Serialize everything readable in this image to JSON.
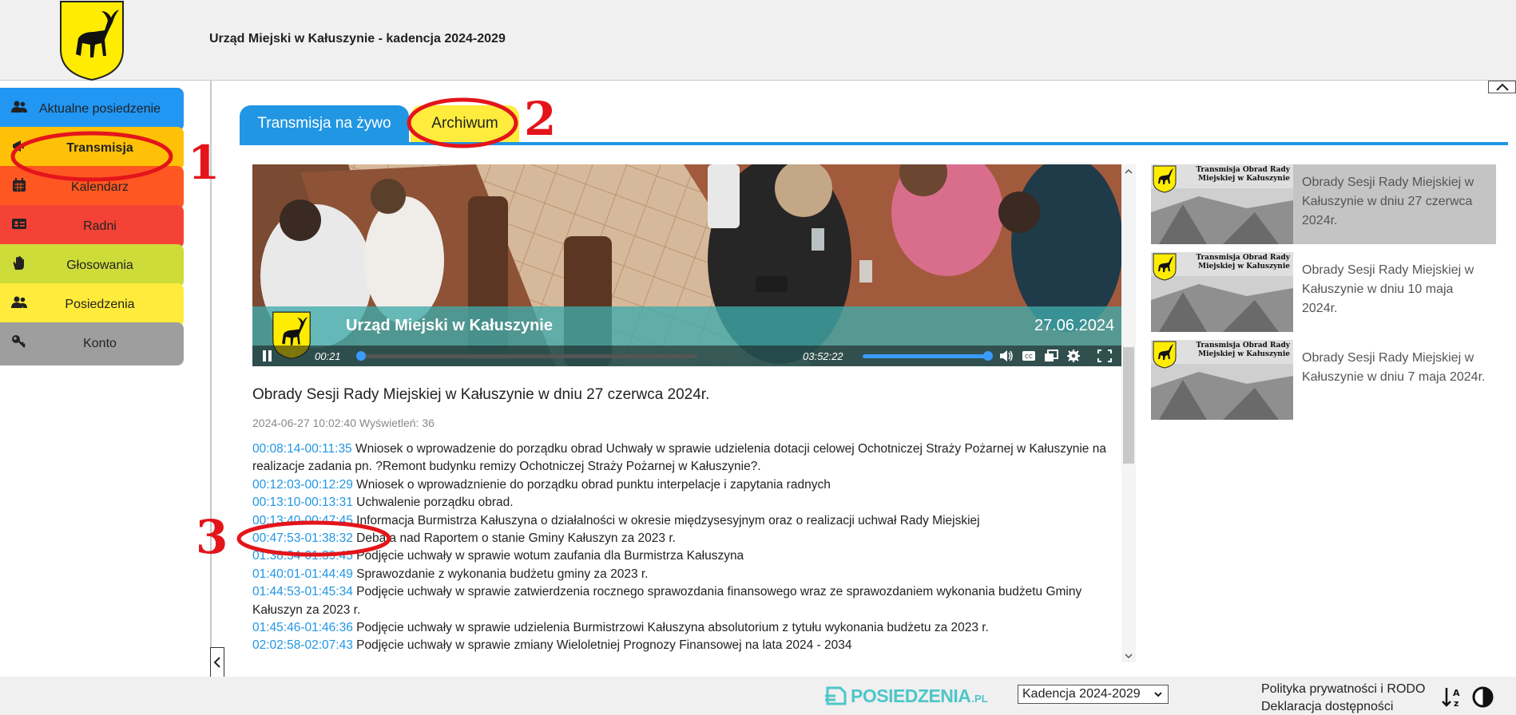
{
  "header": {
    "title": "Urząd Miejski w Kałuszynie - kadencja 2024-2029",
    "logo_icon": "goat-coat-of-arms-icon"
  },
  "sidebar": {
    "items": [
      {
        "label": "Aktualne posiedzenie",
        "icon": "users-icon",
        "color": "#2196f3",
        "text_color": "#222"
      },
      {
        "label": "Transmisja",
        "icon": "broadcast-icon",
        "color": "#ffc107",
        "text_color": "#222",
        "bold": true
      },
      {
        "label": "Kalendarz",
        "icon": "calendar-icon",
        "color": "#ff5722",
        "text_color": "#222"
      },
      {
        "label": "Radni",
        "icon": "id-card-icon",
        "color": "#f44336",
        "text_color": "#222"
      },
      {
        "label": "Głosowania",
        "icon": "hand-icon",
        "color": "#cddc39",
        "text_color": "#222"
      },
      {
        "label": "Posiedzenia",
        "icon": "users-icon",
        "color": "#ffeb3b",
        "text_color": "#222"
      },
      {
        "label": "Konto",
        "icon": "key-icon",
        "color": "#9e9e9e",
        "text_color": "#222"
      }
    ]
  },
  "tabs": {
    "live": "Transmisja na żywo",
    "archive": "Archiwum"
  },
  "player": {
    "overlay_title": "Urząd Miejski w Kałuszynie",
    "overlay_date": "27.06.2024",
    "time_current": "00:21",
    "time_total": "03:52:22",
    "progress_fraction": 0.0015,
    "volume_fraction": 1.0
  },
  "session": {
    "title": "Obrady Sesji Rady Miejskiej w Kałuszynie w dniu 27 czerwca 2024r.",
    "meta": "2024-06-27 10:02:40 Wyświetleń: 36"
  },
  "agenda": [
    {
      "time": "00:08:14-00:11:35",
      "text": "Wniosek o wprowadzenie do porządku obrad Uchwały w sprawie udzielenia dotacji celowej Ochotniczej Straży Pożarnej w Kałuszynie na realizacje zadania pn. ?Remont budynku remizy Ochotniczej Straży Pożarnej w Kałuszynie?."
    },
    {
      "time": "00:12:03-00:12:29",
      "text": "Wniosek o wprowadznienie do porządku obrad punktu interpelacje i zapytania radnych"
    },
    {
      "time": "00:13:10-00:13:31",
      "text": "Uchwalenie porządku obrad."
    },
    {
      "time": "00:13:40-00:47:45",
      "text": "Informacja Burmistrza Kałuszyna o działalności w okresie międzysesyjnym oraz o realizacji uchwał Rady Miejskiej"
    },
    {
      "time": "00:47:53-01:38:32",
      "text": "Debata nad Raportem o stanie Gminy Kałuszyn za 2023 r."
    },
    {
      "time": "01:38:34-01:39:45",
      "text": "Podjęcie uchwały w sprawie wotum zaufania dla Burmistrza Kałuszyna"
    },
    {
      "time": "01:40:01-01:44:49",
      "text": "Sprawozdanie z wykonania budżetu gminy za 2023 r."
    },
    {
      "time": "01:44:53-01:45:34",
      "text": "Podjęcie uchwały w sprawie zatwierdzenia rocznego sprawozdania finansowego wraz ze sprawozdaniem wykonania budżetu Gminy Kałuszyn za 2023 r."
    },
    {
      "time": "01:45:46-01:46:36",
      "text": "Podjęcie uchwały w sprawie udzielenia Burmistrzowi Kałuszyna absolutorium z tytułu wykonania budżetu za 2023 r."
    },
    {
      "time": "02:02:58-02:07:43",
      "text": "Podjęcie uchwały w sprawie zmiany Wieloletniej Prognozy Finansowej na lata 2024 - 2034"
    }
  ],
  "archive": [
    {
      "title": "Obrady Sesji Rady Miejskiej w Kałuszynie w dniu 27 czerwca 2024r.",
      "thumb_title": "Transmisja Obrad Rady Miejskiej w Kałuszynie",
      "active": true
    },
    {
      "title": "Obrady Sesji Rady Miejskiej w Kałuszynie w dniu 10 maja 2024r.",
      "thumb_title": "Transmisja Obrad Rady Miejskiej w Kałuszynie",
      "active": false
    },
    {
      "title": "Obrady Sesji Rady Miejskiej w Kałuszynie w dniu 7 maja 2024r.",
      "thumb_title": "Transmisja Obrad Rady Miejskiej w Kałuszynie",
      "active": false
    }
  ],
  "footer": {
    "brand": "POSIEDZENIA",
    "brand_tld": ".PL",
    "term_select": "Kadencja 2024-2029",
    "privacy": "Polityka prywatności i RODO",
    "accessibility": "Deklaracja dostępności"
  },
  "annotations": [
    "1",
    "2",
    "3"
  ],
  "colors": {
    "accent": "#2196e3",
    "annotation_red": "#e3151b",
    "overlay": "#40aaaa"
  }
}
